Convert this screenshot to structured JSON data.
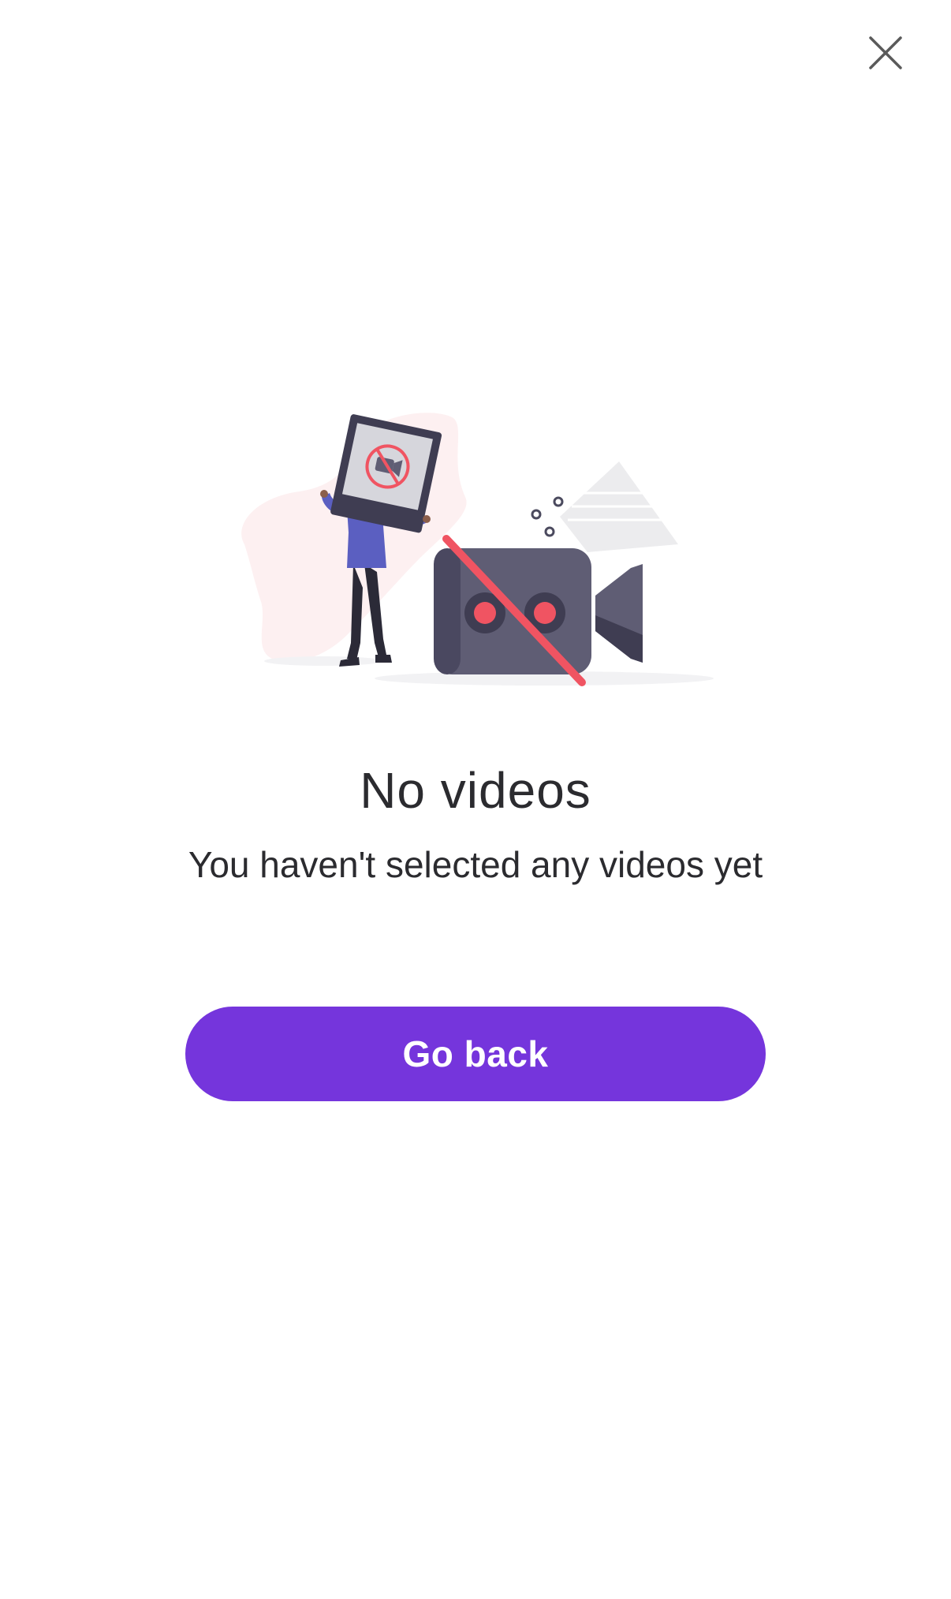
{
  "header": {
    "close_icon": "close-icon"
  },
  "illustration": {
    "icon": "no-video-camera-illustration"
  },
  "empty_state": {
    "title": "No videos",
    "message": "You haven't selected any videos yet"
  },
  "actions": {
    "go_back_label": "Go back"
  },
  "colors": {
    "accent": "#7535dc",
    "text": "#2b2b2f",
    "background": "#ffffff",
    "illustration_red": "#f05462",
    "illustration_gray": "#5f5d74",
    "illustration_blob": "#fdf0f1"
  }
}
